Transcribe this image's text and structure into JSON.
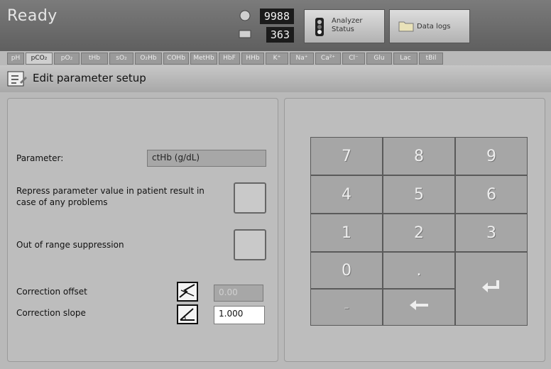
{
  "status": {
    "text": "Ready"
  },
  "counters": {
    "top": "9988",
    "bottom": "363"
  },
  "buttons": {
    "analyzer_status": "Analyzer\nStatus",
    "data_logs": "Data logs"
  },
  "tabs": [
    "pH",
    "pCO₂",
    "pO₂",
    "tHb",
    "sO₂",
    "O₂Hb",
    "COHb",
    "MetHb",
    "HbF",
    "HHb",
    "K⁺",
    "Na⁺",
    "Ca²⁺",
    "Cl⁻",
    "Glu",
    "Lac",
    "tBil"
  ],
  "page": {
    "title": "Edit parameter setup"
  },
  "form": {
    "parameter_label": "Parameter:",
    "parameter_value": "ctHb  (g/dL)",
    "repress_label": "Repress parameter value in patient result in case of any problems",
    "out_of_range_label": "Out of range suppression",
    "correction_offset_label": "Correction offset",
    "correction_offset_value": "0.00",
    "correction_slope_label": "Correction slope",
    "correction_slope_value": "1.000"
  },
  "keypad": {
    "keys": [
      "7",
      "8",
      "9",
      "4",
      "5",
      "6",
      "1",
      "2",
      "3",
      "0",
      "."
    ],
    "minus": "-",
    "enter_icon": "enter-arrow-icon",
    "backspace_icon": "back-arrow-icon"
  }
}
